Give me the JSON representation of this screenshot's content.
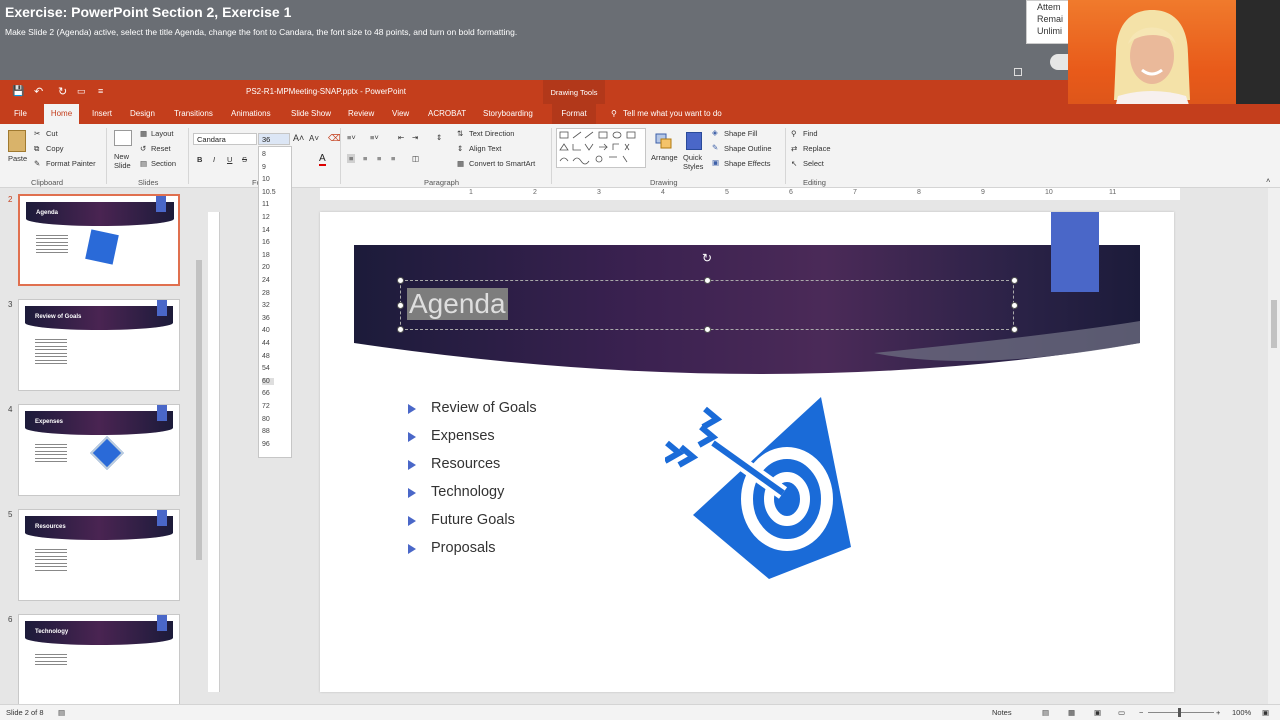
{
  "exercise": {
    "title": "Exercise: PowerPoint Section 2, Exercise 1",
    "description": "Make Slide 2 (Agenda) active, select the title Agenda, change the font to Candara, the font size to 48 points, and turn on bold formatting.",
    "box_lines": [
      "Attem",
      "Remai",
      "Unlimi"
    ]
  },
  "titlebar": {
    "filename": "PS2-R1-MPMeeting-SNAP.pptx - PowerPoint",
    "drawing_tools": "Drawing Tools"
  },
  "tabs": [
    "File",
    "Home",
    "Insert",
    "Design",
    "Transitions",
    "Animations",
    "Slide Show",
    "Review",
    "View",
    "ACROBAT",
    "Storyboarding",
    "Format"
  ],
  "tellme": "Tell me what you want to do",
  "ribbon": {
    "clipboard": {
      "paste": "Paste",
      "cut": "Cut",
      "copy": "Copy",
      "format_painter": "Format Painter",
      "label": "Clipboard"
    },
    "slides": {
      "new_slide": "New Slide",
      "layout": "Layout",
      "reset": "Reset",
      "section": "Section",
      "label": "Slides"
    },
    "font": {
      "name": "Candara",
      "size": "36",
      "label": "Fo"
    },
    "paragraph": {
      "text_direction": "Text Direction",
      "align_text": "Align Text",
      "smartart": "Convert to SmartArt",
      "label": "Paragraph"
    },
    "drawing": {
      "arrange": "Arrange",
      "quick_styles": "Quick Styles",
      "shape_fill": "Shape Fill",
      "shape_outline": "Shape Outline",
      "shape_effects": "Shape Effects",
      "label": "Drawing"
    },
    "editing": {
      "find": "Find",
      "replace": "Replace",
      "select": "Select",
      "label": "Editing"
    }
  },
  "font_sizes": [
    "8",
    "9",
    "10",
    "10.5",
    "11",
    "12",
    "14",
    "16",
    "18",
    "20",
    "24",
    "28",
    "32",
    "36",
    "40",
    "44",
    "48",
    "54",
    "60",
    "66",
    "72",
    "80",
    "88",
    "96"
  ],
  "font_size_highlighted": "60",
  "ruler_marks": [
    "1",
    "2",
    "3",
    "4",
    "5",
    "6",
    "7",
    "8",
    "9",
    "10",
    "11"
  ],
  "thumbnails": [
    {
      "num": "2",
      "title": "Agenda",
      "selected": true
    },
    {
      "num": "3",
      "title": "Review of Goals",
      "selected": false
    },
    {
      "num": "4",
      "title": "Expenses",
      "selected": false
    },
    {
      "num": "5",
      "title": "Resources",
      "selected": false
    },
    {
      "num": "6",
      "title": "Technology",
      "selected": false
    }
  ],
  "slide": {
    "title": "Agenda",
    "bullets": [
      "Review of Goals",
      "Expenses",
      "Resources",
      "Technology",
      "Future Goals",
      "Proposals"
    ]
  },
  "status": {
    "slide_of": "Slide 2 of 8",
    "notes": "Notes",
    "zoom": "100%"
  },
  "colors": {
    "ppt_red": "#c43e1c",
    "accent_blue": "#4a67c8",
    "banner_dark": "#1c1b3a"
  }
}
